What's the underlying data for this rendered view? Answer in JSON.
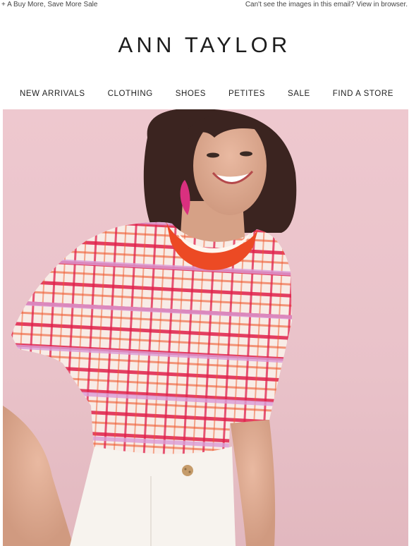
{
  "preheader": {
    "left": "+ A Buy More, Save More Sale",
    "right": "Can't see the images in this email? View in browser."
  },
  "brand": {
    "logo_text": "ANN TAYLOR"
  },
  "nav": {
    "items": [
      {
        "label": "NEW ARRIVALS"
      },
      {
        "label": "CLOTHING"
      },
      {
        "label": "SHOES"
      },
      {
        "label": "PETITES"
      },
      {
        "label": "SALE"
      },
      {
        "label": "FIND A STORE"
      }
    ]
  },
  "colors": {
    "background": "#ffffff",
    "hero_background": "#eec8cf",
    "sweater_red": "#e0204a",
    "sweater_orange": "#ef5a2e",
    "sweater_lilac": "#d99bd6",
    "sweater_base": "#f8ece6"
  },
  "hero": {
    "image": "model-in-grid-knit-sweater"
  }
}
